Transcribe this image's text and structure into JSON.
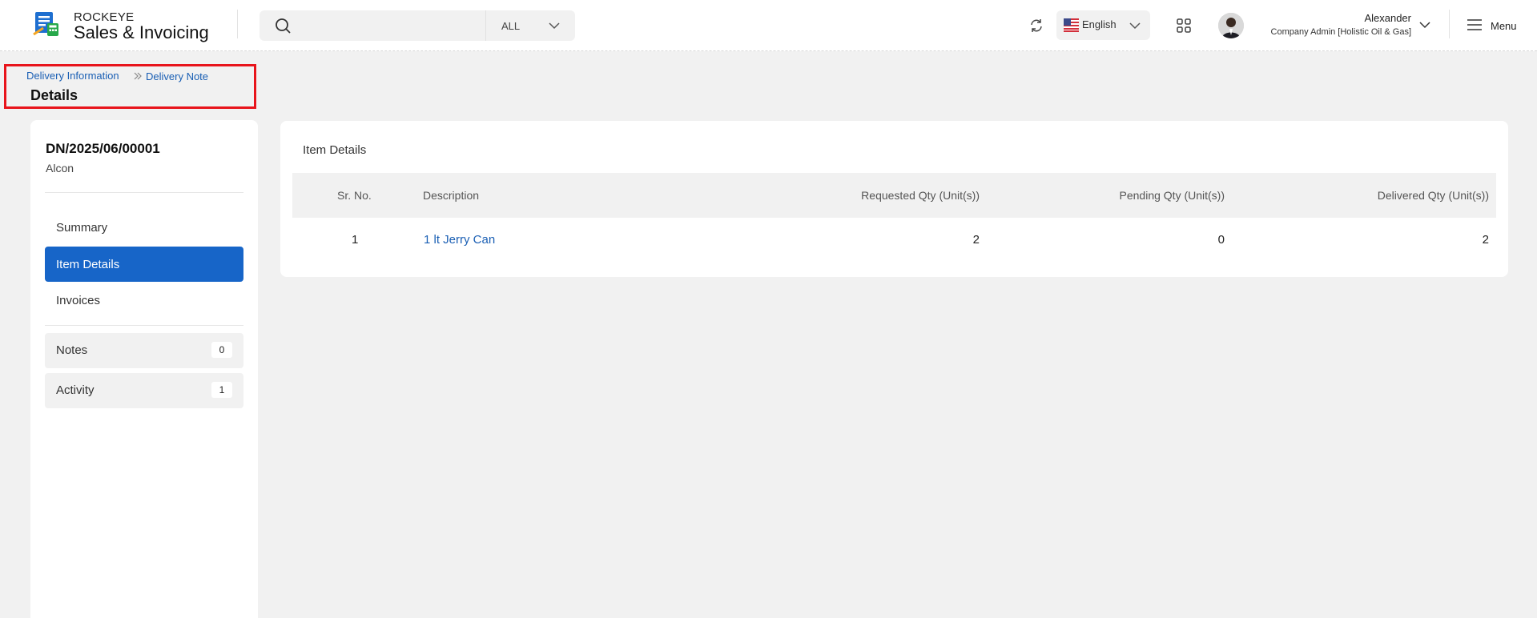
{
  "app": {
    "brand_small": "ROCKEYE",
    "brand_big": "Sales & Invoicing"
  },
  "search": {
    "placeholder": "",
    "scope": "ALL"
  },
  "header": {
    "language": "English",
    "user_name": "Alexander",
    "user_role": "Company Admin [Holistic Oil & Gas]",
    "menu_label": "Menu"
  },
  "breadcrumb": {
    "items": [
      "Delivery Information",
      "Delivery Note"
    ],
    "title": "Details"
  },
  "sidebar": {
    "doc_number": "DN/2025/06/00001",
    "customer": "Alcon",
    "nav": [
      {
        "label": "Summary"
      },
      {
        "label": "Item Details",
        "active": true
      },
      {
        "label": "Invoices"
      }
    ],
    "extras": [
      {
        "label": "Notes",
        "count": "0"
      },
      {
        "label": "Activity",
        "count": "1"
      }
    ]
  },
  "item_details": {
    "title": "Item Details",
    "columns": [
      "Sr. No.",
      "Description",
      "Requested Qty (Unit(s))",
      "Pending Qty (Unit(s))",
      "Delivered Qty (Unit(s))"
    ],
    "rows": [
      {
        "sr_no": "1",
        "description": "1 lt Jerry Can",
        "requested": "2",
        "pending": "0",
        "delivered": "2"
      }
    ]
  },
  "colors": {
    "accent": "#1765c8",
    "link": "#1a5fb4",
    "highlight": "#e8141b"
  }
}
